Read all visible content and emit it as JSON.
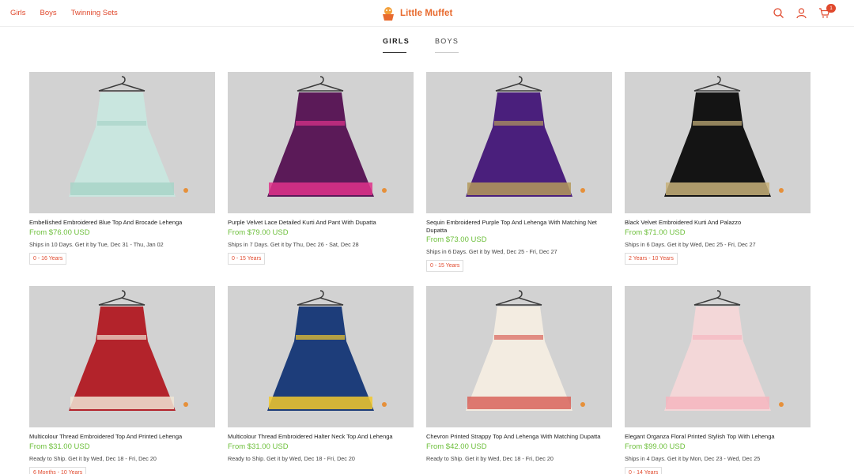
{
  "header": {
    "nav": [
      "Girls",
      "Boys",
      "Twinning Sets"
    ],
    "brand": "Little Muffet",
    "cart_count": "1",
    "icons": [
      "search-icon",
      "user-icon",
      "cart-icon"
    ],
    "accent_color": "#e0492d"
  },
  "tabs": [
    "GIRLS",
    "BOYS"
  ],
  "products": [
    {
      "title": "Embellished Embroidered Blue Top And Brocade Lehenga",
      "price": "From $76.00 USD",
      "ship": "Ships in 10 Days. Get it by Tue, Dec 31 - Thu, Jan 02",
      "age": "0 - 16 Years",
      "main": "#c9e6df",
      "accent": "#a8d3c8"
    },
    {
      "title": "Purple Velvet Lace Detailed Kurti And Pant With Dupatta",
      "price": "From $79.00 USD",
      "ship": "Ships in 7 Days. Get it by Thu, Dec 26 - Sat, Dec 28",
      "age": "0 - 15 Years",
      "main": "#5b1a58",
      "accent": "#e0338b"
    },
    {
      "title": "Sequin Embroidered Purple Top And Lehenga With Matching Net Dupatta",
      "price": "From $73.00 USD",
      "ship": "Ships in 6 Days. Get it by Wed, Dec 25 - Fri, Dec 27",
      "age": "0 - 15 Years",
      "main": "#4a1f7c",
      "accent": "#b49a5c"
    },
    {
      "title": "Black Velvet Embroidered Kurti And Palazzo",
      "price": "From $71.00 USD",
      "ship": "Ships in 6 Days. Get it by Wed, Dec 25 - Fri, Dec 27",
      "age": "2 Years - 10 Years",
      "main": "#141414",
      "accent": "#c8b27a"
    },
    {
      "title": "Multicolour Thread Embroidered Top And Printed Lehenga",
      "price": "From $31.00 USD",
      "ship": "Ready to Ship. Get it by Wed, Dec 18 - Fri, Dec 20",
      "age": "6 Months - 10 Years",
      "main": "#b3232b",
      "accent": "#f0e6d6"
    },
    {
      "title": "Multicolour Thread Embroidered Halter Neck Top And Lehenga",
      "price": "From $31.00 USD",
      "ship": "Ready to Ship. Get it by Wed, Dec 18 - Fri, Dec 20",
      "age": "",
      "main": "#1d3d7a",
      "accent": "#f3c92d"
    },
    {
      "title": "Chevron Printed Strappy Top And Lehenga With Matching Dupatta",
      "price": "From $42.00 USD",
      "ship": "Ready to Ship. Get it by Wed, Dec 18 - Fri, Dec 20",
      "age": "",
      "main": "#f3ece1",
      "accent": "#d8645a"
    },
    {
      "title": "Elegant Organza Floral Printed Stylish Top With Lehenga",
      "price": "From $99.00 USD",
      "ship": "Ships in 4 Days. Get it by Mon, Dec 23 - Wed, Dec 25",
      "age": "0 - 14 Years",
      "main": "#f3d7d8",
      "accent": "#f5b6c0"
    }
  ]
}
